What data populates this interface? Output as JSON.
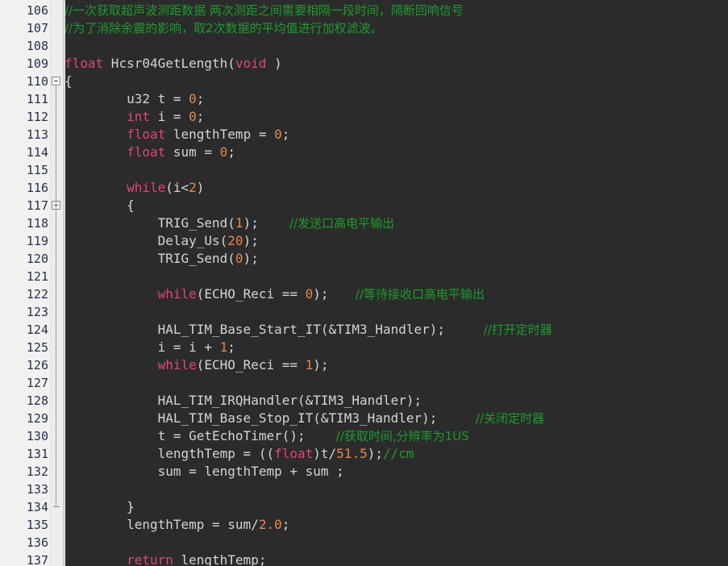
{
  "editor": {
    "language": "c",
    "theme": "dark",
    "colors": {
      "background": "#2b2b2b",
      "gutter_background": "#f1f1f1",
      "line_number": "#24304a",
      "keyword": "#e0457b",
      "number": "#e8864a",
      "identifier": "#d4d4d4",
      "comment": "#1f9a2e"
    },
    "first_visible_line": 106,
    "last_visible_line": 137
  },
  "lines": [
    {
      "number": "106",
      "indent": 0,
      "fold": "none",
      "tokens": [
        {
          "t": "cmt",
          "v": "//一次获取超声波测距数据 两次测距之间需要相隔一段时间，隔断回响信号"
        }
      ]
    },
    {
      "number": "107",
      "indent": 0,
      "fold": "none",
      "tokens": [
        {
          "t": "cmt",
          "v": "//为了消除余震的影响，取2次数据的平均值进行加权滤波。"
        }
      ]
    },
    {
      "number": "108",
      "indent": 0,
      "fold": "none",
      "tokens": []
    },
    {
      "number": "109",
      "indent": 0,
      "fold": "none",
      "tokens": [
        {
          "t": "kw",
          "v": "float"
        },
        {
          "t": "id",
          "v": " Hcsr04GetLength("
        },
        {
          "t": "kw",
          "v": "void"
        },
        {
          "t": "punc",
          "v": " )"
        }
      ]
    },
    {
      "number": "110",
      "indent": 0,
      "fold": "open",
      "tokens": [
        {
          "t": "punc",
          "v": "{"
        }
      ]
    },
    {
      "number": "111",
      "indent": 0,
      "fold": "none",
      "tokens": [
        {
          "t": "id",
          "v": "        u32 t = "
        },
        {
          "t": "num",
          "v": "0"
        },
        {
          "t": "punc",
          "v": ";"
        }
      ]
    },
    {
      "number": "112",
      "indent": 0,
      "fold": "none",
      "tokens": [
        {
          "t": "id",
          "v": "        "
        },
        {
          "t": "kw",
          "v": "int"
        },
        {
          "t": "id",
          "v": " i = "
        },
        {
          "t": "num",
          "v": "0"
        },
        {
          "t": "punc",
          "v": ";"
        }
      ]
    },
    {
      "number": "113",
      "indent": 0,
      "fold": "none",
      "tokens": [
        {
          "t": "id",
          "v": "        "
        },
        {
          "t": "kw",
          "v": "float"
        },
        {
          "t": "id",
          "v": " lengthTemp = "
        },
        {
          "t": "num",
          "v": "0"
        },
        {
          "t": "punc",
          "v": ";"
        }
      ]
    },
    {
      "number": "114",
      "indent": 0,
      "fold": "none",
      "tokens": [
        {
          "t": "id",
          "v": "        "
        },
        {
          "t": "kw",
          "v": "float"
        },
        {
          "t": "id",
          "v": " sum = "
        },
        {
          "t": "num",
          "v": "0"
        },
        {
          "t": "punc",
          "v": ";"
        }
      ]
    },
    {
      "number": "115",
      "indent": 0,
      "fold": "none",
      "tokens": []
    },
    {
      "number": "116",
      "indent": 0,
      "fold": "none",
      "tokens": [
        {
          "t": "id",
          "v": "        "
        },
        {
          "t": "kw",
          "v": "while"
        },
        {
          "t": "punc",
          "v": "("
        },
        {
          "t": "id",
          "v": "i<"
        },
        {
          "t": "num",
          "v": "2"
        },
        {
          "t": "punc",
          "v": ")"
        }
      ]
    },
    {
      "number": "117",
      "indent": 0,
      "fold": "open",
      "tokens": [
        {
          "t": "punc",
          "v": "        {"
        }
      ]
    },
    {
      "number": "118",
      "indent": 0,
      "fold": "none",
      "tokens": [
        {
          "t": "id",
          "v": "            TRIG_Send("
        },
        {
          "t": "num",
          "v": "1"
        },
        {
          "t": "punc",
          "v": ");"
        },
        {
          "t": "cmt",
          "v": "        //发送口高电平输出"
        }
      ]
    },
    {
      "number": "119",
      "indent": 0,
      "fold": "none",
      "tokens": [
        {
          "t": "id",
          "v": "            Delay_Us("
        },
        {
          "t": "num",
          "v": "20"
        },
        {
          "t": "punc",
          "v": ");"
        }
      ]
    },
    {
      "number": "120",
      "indent": 0,
      "fold": "none",
      "tokens": [
        {
          "t": "id",
          "v": "            TRIG_Send("
        },
        {
          "t": "num",
          "v": "0"
        },
        {
          "t": "punc",
          "v": ");"
        }
      ]
    },
    {
      "number": "121",
      "indent": 0,
      "fold": "none",
      "tokens": []
    },
    {
      "number": "122",
      "indent": 0,
      "fold": "none",
      "tokens": [
        {
          "t": "id",
          "v": "            "
        },
        {
          "t": "kw",
          "v": "while"
        },
        {
          "t": "punc",
          "v": "("
        },
        {
          "t": "id",
          "v": "ECHO_Reci == "
        },
        {
          "t": "num",
          "v": "0"
        },
        {
          "t": "punc",
          "v": ");"
        },
        {
          "t": "cmt",
          "v": "       //等待接收口高电平输出"
        }
      ]
    },
    {
      "number": "123",
      "indent": 0,
      "fold": "none",
      "tokens": []
    },
    {
      "number": "124",
      "indent": 0,
      "fold": "none",
      "tokens": [
        {
          "t": "id",
          "v": "            HAL_TIM_Base_Start_IT(&TIM3_Handler);"
        },
        {
          "t": "cmt",
          "v": "          //打开定时器"
        }
      ]
    },
    {
      "number": "125",
      "indent": 0,
      "fold": "none",
      "tokens": [
        {
          "t": "id",
          "v": "            i = i + "
        },
        {
          "t": "num",
          "v": "1"
        },
        {
          "t": "punc",
          "v": ";"
        }
      ]
    },
    {
      "number": "126",
      "indent": 0,
      "fold": "none",
      "tokens": [
        {
          "t": "id",
          "v": "            "
        },
        {
          "t": "kw",
          "v": "while"
        },
        {
          "t": "punc",
          "v": "("
        },
        {
          "t": "id",
          "v": "ECHO_Reci == "
        },
        {
          "t": "num",
          "v": "1"
        },
        {
          "t": "punc",
          "v": ");"
        }
      ]
    },
    {
      "number": "127",
      "indent": 0,
      "fold": "none",
      "tokens": []
    },
    {
      "number": "128",
      "indent": 0,
      "fold": "none",
      "tokens": [
        {
          "t": "id",
          "v": "            HAL_TIM_IRQHandler(&TIM3_Handler);"
        }
      ]
    },
    {
      "number": "129",
      "indent": 0,
      "fold": "none",
      "tokens": [
        {
          "t": "id",
          "v": "            HAL_TIM_Base_Stop_IT(&TIM3_Handler);"
        },
        {
          "t": "cmt",
          "v": "          //关闭定时器"
        }
      ]
    },
    {
      "number": "130",
      "indent": 0,
      "fold": "none",
      "tokens": [
        {
          "t": "id",
          "v": "            t = GetEchoTimer();"
        },
        {
          "t": "cmt",
          "v": "        //获取时间,分辨率为1US"
        }
      ]
    },
    {
      "number": "131",
      "indent": 0,
      "fold": "none",
      "tokens": [
        {
          "t": "id",
          "v": "            lengthTemp = (("
        },
        {
          "t": "kw",
          "v": "float"
        },
        {
          "t": "id",
          "v": ")t/"
        },
        {
          "t": "num",
          "v": "51.5"
        },
        {
          "t": "punc",
          "v": ");"
        },
        {
          "t": "cmt-mono",
          "v": "//cm"
        }
      ]
    },
    {
      "number": "132",
      "indent": 0,
      "fold": "none",
      "tokens": [
        {
          "t": "id",
          "v": "            sum = lengthTemp + sum ;"
        }
      ]
    },
    {
      "number": "133",
      "indent": 0,
      "fold": "none",
      "tokens": []
    },
    {
      "number": "134",
      "indent": 0,
      "fold": "end",
      "tokens": [
        {
          "t": "punc",
          "v": "        }"
        }
      ]
    },
    {
      "number": "135",
      "indent": 0,
      "fold": "none",
      "tokens": [
        {
          "t": "id",
          "v": "        lengthTemp = sum/"
        },
        {
          "t": "num",
          "v": "2.0"
        },
        {
          "t": "punc",
          "v": ";"
        }
      ]
    },
    {
      "number": "136",
      "indent": 0,
      "fold": "none",
      "tokens": []
    },
    {
      "number": "137",
      "indent": 0,
      "fold": "none",
      "tokens": [
        {
          "t": "id",
          "v": "        "
        },
        {
          "t": "kw",
          "v": "return"
        },
        {
          "t": "id",
          "v": " lengthTemp;"
        }
      ]
    }
  ]
}
